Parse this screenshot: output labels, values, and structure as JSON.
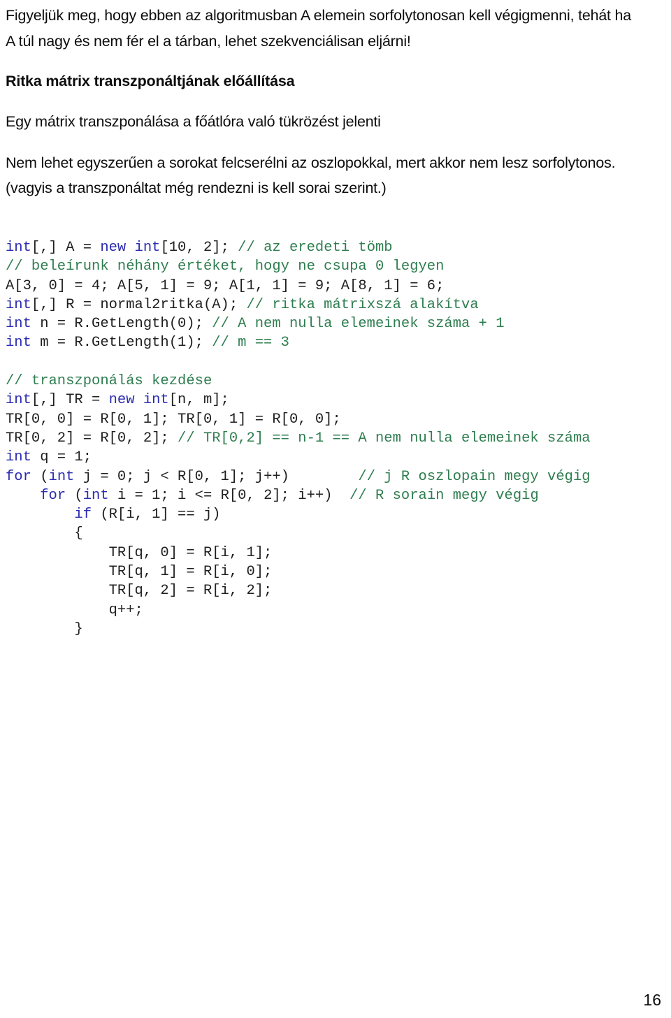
{
  "document": {
    "page_number": "16",
    "colors": {
      "text": "#0d0d0d",
      "code_keyword": "#2b2bb0",
      "code_comment": "#2e7d4f",
      "code_plain": "#1f1f1f",
      "background": "#ffffff"
    }
  },
  "intro": {
    "line1": "Figyeljük meg, hogy ebben az algoritmusban A elemein sorfolytonosan kell végigmenni, tehát ha",
    "line2": "A túl nagy és nem fér el a tárban, lehet szekvenciálisan eljárni!"
  },
  "section": {
    "heading": "Ritka mátrix transzponáltjának előállítása",
    "para1": "Egy mátrix transzponálása a főátlóra való tükrözést jelenti",
    "para2_line1": "Nem lehet egyszerűen a sorokat felcserélni az oszlopokkal, mert akkor nem lesz sorfolytonos.",
    "para2_line2": "(vagyis a transzponáltat még rendezni is kell sorai szerint.)"
  },
  "code": {
    "lines": [
      [
        {
          "t": "int",
          "c": "kw"
        },
        {
          "t": "[,] A = ",
          "c": "plain"
        },
        {
          "t": "new int",
          "c": "kw"
        },
        {
          "t": "[10, 2]; ",
          "c": "plain"
        },
        {
          "t": "// az eredeti tömb",
          "c": "cmt"
        }
      ],
      [
        {
          "t": "// beleírunk néhány értéket, hogy ne csupa 0 legyen",
          "c": "cmt"
        }
      ],
      [
        {
          "t": "A[3, 0] = 4; A[5, 1] = 9; A[1, 1] = 9; A[8, 1] = 6;",
          "c": "plain"
        }
      ],
      [
        {
          "t": "int",
          "c": "kw"
        },
        {
          "t": "[,] R = normal2ritka(A); ",
          "c": "plain"
        },
        {
          "t": "// ritka mátrixszá alakítva",
          "c": "cmt"
        }
      ],
      [
        {
          "t": "int",
          "c": "kw"
        },
        {
          "t": " n = R.GetLength(0); ",
          "c": "plain"
        },
        {
          "t": "// A nem nulla elemeinek száma + 1",
          "c": "cmt"
        }
      ],
      [
        {
          "t": "int",
          "c": "kw"
        },
        {
          "t": " m = R.GetLength(1); ",
          "c": "plain"
        },
        {
          "t": "// m == 3",
          "c": "cmt"
        }
      ],
      [],
      [
        {
          "t": "// transzponálás kezdése",
          "c": "cmt"
        }
      ],
      [
        {
          "t": "int",
          "c": "kw"
        },
        {
          "t": "[,] TR = ",
          "c": "plain"
        },
        {
          "t": "new int",
          "c": "kw"
        },
        {
          "t": "[n, m];",
          "c": "plain"
        }
      ],
      [
        {
          "t": "TR[0, 0] = R[0, 1]; TR[0, 1] = R[0, 0];",
          "c": "plain"
        }
      ],
      [
        {
          "t": "TR[0, 2] = R[0, 2]; ",
          "c": "plain"
        },
        {
          "t": "// TR[0,2] == n-1 == A nem nulla elemeinek száma",
          "c": "cmt"
        }
      ],
      [
        {
          "t": "int",
          "c": "kw"
        },
        {
          "t": " q = 1;",
          "c": "plain"
        }
      ],
      [
        {
          "t": "for",
          "c": "kw"
        },
        {
          "t": " (",
          "c": "plain"
        },
        {
          "t": "int",
          "c": "kw"
        },
        {
          "t": " j = 0; j < R[0, 1]; j++)        ",
          "c": "plain"
        },
        {
          "t": "// j R oszlopain megy végig",
          "c": "cmt"
        }
      ],
      [
        {
          "t": "    ",
          "c": "plain"
        },
        {
          "t": "for",
          "c": "kw"
        },
        {
          "t": " (",
          "c": "plain"
        },
        {
          "t": "int",
          "c": "kw"
        },
        {
          "t": " i = 1; i <= R[0, 2]; i++)  ",
          "c": "plain"
        },
        {
          "t": "// R sorain megy végig",
          "c": "cmt"
        }
      ],
      [
        {
          "t": "        ",
          "c": "plain"
        },
        {
          "t": "if",
          "c": "kw"
        },
        {
          "t": " (R[i, 1] == j)",
          "c": "plain"
        }
      ],
      [
        {
          "t": "        {",
          "c": "plain"
        }
      ],
      [
        {
          "t": "            TR[q, 0] = R[i, 1];",
          "c": "plain"
        }
      ],
      [
        {
          "t": "            TR[q, 1] = R[i, 0];",
          "c": "plain"
        }
      ],
      [
        {
          "t": "            TR[q, 2] = R[i, 2];",
          "c": "plain"
        }
      ],
      [
        {
          "t": "            q++;",
          "c": "plain"
        }
      ],
      [
        {
          "t": "        }",
          "c": "plain"
        }
      ]
    ]
  }
}
